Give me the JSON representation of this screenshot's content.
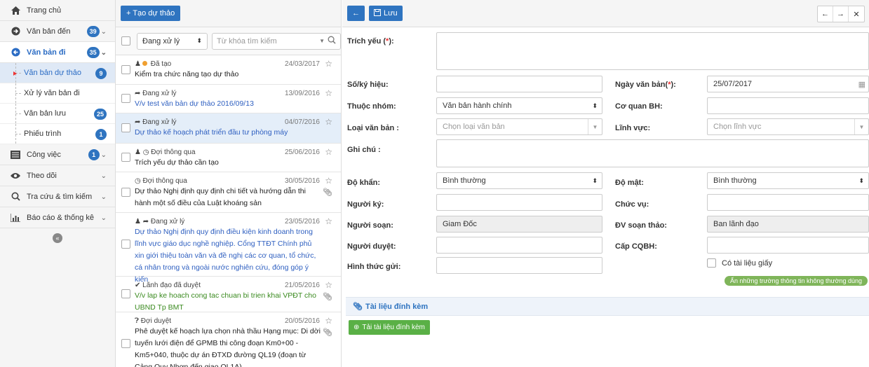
{
  "sidebar": {
    "home": "Trang chủ",
    "incoming": {
      "label": "Văn bản đến",
      "badge": "39"
    },
    "outgoing": {
      "label": "Văn bản đi",
      "badge": "35"
    },
    "sub": [
      {
        "label": "Văn bản dự thảo",
        "badge": "9"
      },
      {
        "label": "Xử lý văn bản đi",
        "badge": ""
      },
      {
        "label": "Văn bản lưu",
        "badge": "25"
      },
      {
        "label": "Phiếu trình",
        "badge": "1"
      }
    ],
    "tasks": {
      "label": "Công việc",
      "badge": "1"
    },
    "follow": "Theo dõi",
    "lookup": "Tra cứu & tìm kiếm",
    "reports": "Báo cáo & thống kê",
    "collapse_glyph": "«"
  },
  "list": {
    "create_label": "+ Tạo dự thảo",
    "status_select": "Đang xử lý",
    "search_placeholder": "Từ khóa tìm kiếm",
    "items": [
      {
        "status": "Đã tạo",
        "date": "24/03/2017",
        "title": "Kiểm tra chức năng tạo dự thảo"
      },
      {
        "status": "Đang xử lý",
        "date": "13/09/2016",
        "title": "V/v test văn bản dự thảo 2016/09/13"
      },
      {
        "status": "Đang xử lý",
        "date": "04/07/2016",
        "title": "Dự thảo kế hoạch phát triển đầu tư phòng máy"
      },
      {
        "status": "Đợi thông qua",
        "date": "25/06/2016",
        "title": "Trích yếu dự thảo cần tạo"
      },
      {
        "status": "Đợi thông qua",
        "date": "30/05/2016",
        "title": "Dự thảo Nghị định quy định chi tiết và hướng dẫn thi hành một số điều của Luật khoáng sản"
      },
      {
        "status": "Đang xử lý",
        "date": "23/05/2016",
        "title": "Dự thảo Nghị định quy định điều kiện kinh doanh trong lĩnh vực giáo dục nghề nghiệp. Cổng TTĐT Chính phủ xin giới thiệu toàn văn và đề nghị các cơ quan, tổ chức, cá nhân trong và ngoài nước nghiên cứu, đóng góp ý kiến"
      },
      {
        "status": "Lãnh đạo đã duyệt",
        "date": "21/05/2016",
        "title": "V/v lap ke hoach cong tac chuan bi trien khai VPĐT cho UBND Tp BMT"
      },
      {
        "status": "Đợi duyệt",
        "date": "20/05/2016",
        "title": "Phê duyệt kế hoạch lựa chọn nhà thầu Hạng mục: Di dời tuyến lưới điện để GPMB thi công đoạn Km0+00 - Km5+040, thuộc dự án ĐTXD đường QL19 (đoạn từ Cảng Quy Nhơn đến giao QL1A)"
      }
    ]
  },
  "form": {
    "save_label": "Lưu",
    "labels": {
      "summary": "Trích yếu (",
      "summary_req": "*",
      "summary_end": "):",
      "number": "Số/ký hiệu:",
      "date": "Ngày văn bản(",
      "date_req": "*",
      "date_end": "):",
      "group": "Thuộc nhóm:",
      "agency": "Cơ quan BH:",
      "doctype": "Loại văn bản :",
      "field": "Lĩnh vực:",
      "note": "Ghi chú :",
      "urgency": "Độ khẩn:",
      "secrecy": "Độ mật:",
      "signer": "Người ký:",
      "position": "Chức vụ:",
      "composer": "Người soạn:",
      "unit": "ĐV soạn thảo:",
      "approver": "Người duyệt:",
      "level": "Cấp CQBH:",
      "send_method": "Hình thức gửi:",
      "paper": "Có tài liệu giấy"
    },
    "values": {
      "date": "25/07/2017",
      "group": "Văn bản hành chính",
      "doctype_placeholder": "Chọn loại văn bản",
      "field_placeholder": "Chọn lĩnh vực",
      "urgency": "Bình thường",
      "secrecy": "Bình thường",
      "composer": "Giam Đốc",
      "unit": "Ban lãnh đạo"
    },
    "hide_fields_label": "Ẩn những trường thông tin không thường dùng",
    "attachments_title": "Tài liệu đính kèm",
    "upload_label": "Tải tài liệu đính kèm"
  }
}
